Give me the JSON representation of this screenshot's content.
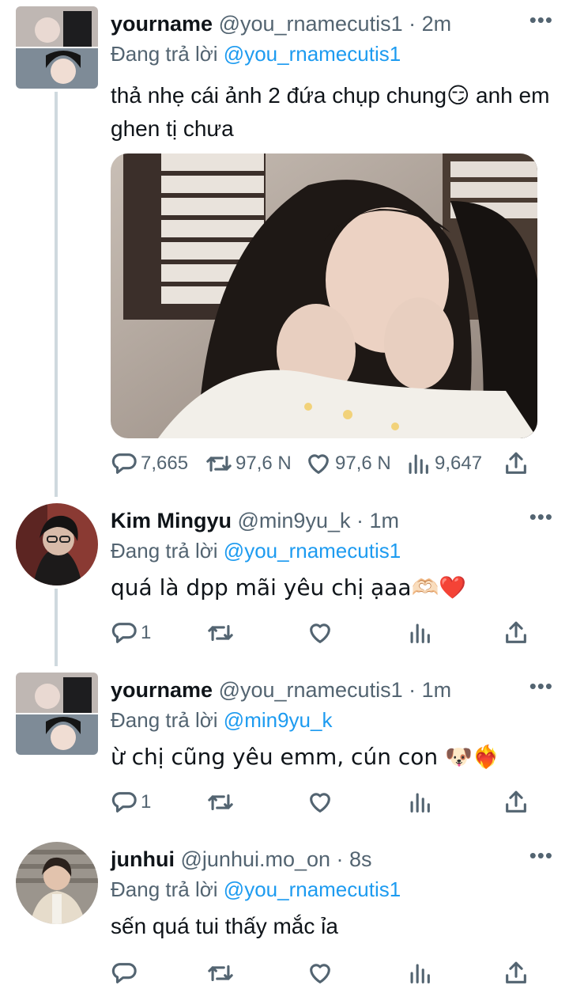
{
  "tweets": [
    {
      "name": "yourname",
      "handle": "@you_rnamecutis1",
      "time": "· 2m",
      "reply_prefix": "Đang trả lời",
      "reply_to": "@you_rnamecutis1",
      "text": "thả nhẹ cái ảnh 2 đứa chụp chung😏 anh em ghen tị chưa",
      "stats": {
        "replies": "7,665",
        "retweets": "97,6 N",
        "likes": "97,6 N",
        "views": "9,647"
      }
    },
    {
      "name": "Kim Mingyu",
      "handle": "@min9yu_k",
      "time": "· 1m",
      "reply_prefix": "Đang trả lời",
      "reply_to": "@you_rnamecutis1",
      "text": "quá là dpp mãi yêu chị ạaa🫶🏻❤️",
      "stats": {
        "replies": "1",
        "retweets": "",
        "likes": "",
        "views": ""
      }
    },
    {
      "name": "yourname",
      "handle": "@you_rnamecutis1",
      "time": "· 1m",
      "reply_prefix": "Đang trả lời",
      "reply_to": "@min9yu_k",
      "text": "ừ chị cũng yêu emm, cún con 🐶❤️‍🔥",
      "stats": {
        "replies": "1",
        "retweets": "",
        "likes": "",
        "views": ""
      }
    },
    {
      "name": "junhui",
      "handle": "@junhui.mo_on",
      "time": "· 8s",
      "reply_prefix": "Đang trả lời",
      "reply_to": "@you_rnamecutis1",
      "text": "sến quá tui thấy mắc ỉa",
      "stats": {
        "replies": "",
        "retweets": "",
        "likes": "",
        "views": ""
      }
    }
  ],
  "icons": {
    "more": "more-dots-icon",
    "reply": "reply-icon",
    "retweet": "retweet-icon",
    "like": "heart-icon",
    "views": "views-icon",
    "share": "share-icon"
  },
  "colors": {
    "link": "#1d9bf0",
    "muted": "#536471",
    "text": "#0f1419",
    "thread": "#cfd9de"
  }
}
